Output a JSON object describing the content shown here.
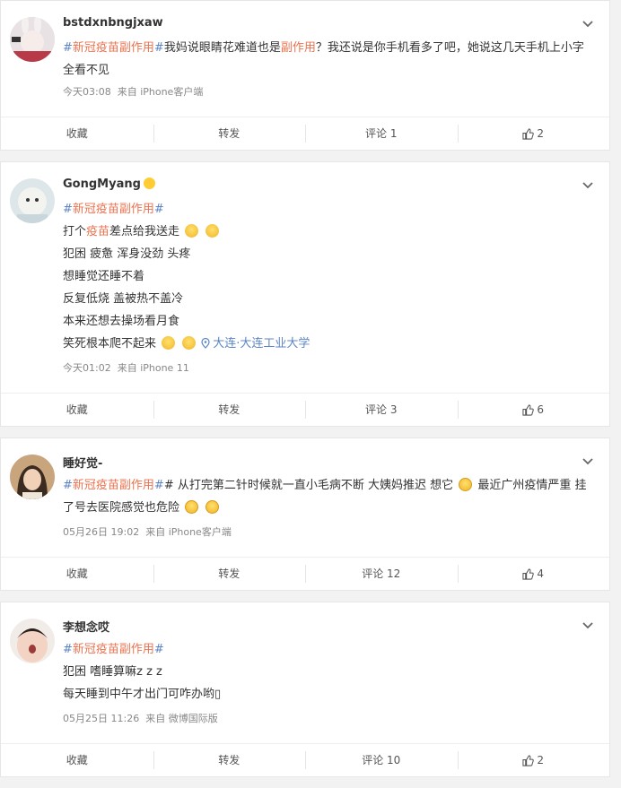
{
  "posts": [
    {
      "username": "bstdxnbngjxaw",
      "tag": "新冠疫苗副作用",
      "text_a": "我妈说眼睛花难道也是",
      "text_red": "副作用",
      "text_b": "？我还说是你手机看多了吧，她说这几天手机上小字全看不见",
      "time": "今天03:08",
      "source": "来自 iPhone客户端",
      "actions": {
        "fav": "收藏",
        "repost": "转发",
        "comment": "评论 1",
        "like": "2"
      }
    },
    {
      "username": "GongMyang",
      "tag": "新冠疫苗副作用",
      "line1_a": "打个",
      "line1_red": "疫苗",
      "line1_b": "差点给我送走",
      "line2": "犯困 疲惫 浑身没劲 头疼",
      "line3": "想睡觉还睡不着",
      "line4": "反复低烧 盖被热不盖冷",
      "line5": "本来还想去操场看月食",
      "line6": "笑死根本爬不起来",
      "location": "大连·大连工业大学",
      "time": "今天01:02",
      "source": "来自 iPhone 11",
      "actions": {
        "fav": "收藏",
        "repost": "转发",
        "comment": "评论 3",
        "like": "6"
      }
    },
    {
      "username": "睡好觉-",
      "tag": "新冠疫苗副作用",
      "text_a": "# 从打完第二针时候就一直小毛病不断 大姨妈推迟 想它",
      "text_b": " 最近广州疫情严重 挂了号去医院感觉也危险 ",
      "time": "05月26日 19:02",
      "source": "来自 iPhone客户端",
      "actions": {
        "fav": "收藏",
        "repost": "转发",
        "comment": "评论 12",
        "like": "4"
      }
    },
    {
      "username": "李想念哎",
      "tag": "新冠疫苗副作用",
      "line1": "犯困 嗜睡算嘛z z z",
      "line2": "每天睡到中午才出门可咋办哟▯",
      "time": "05月25日 11:26",
      "source": "来自 微博国际版",
      "actions": {
        "fav": "收藏",
        "repost": "转发",
        "comment": "评论 10",
        "like": "2"
      }
    }
  ]
}
